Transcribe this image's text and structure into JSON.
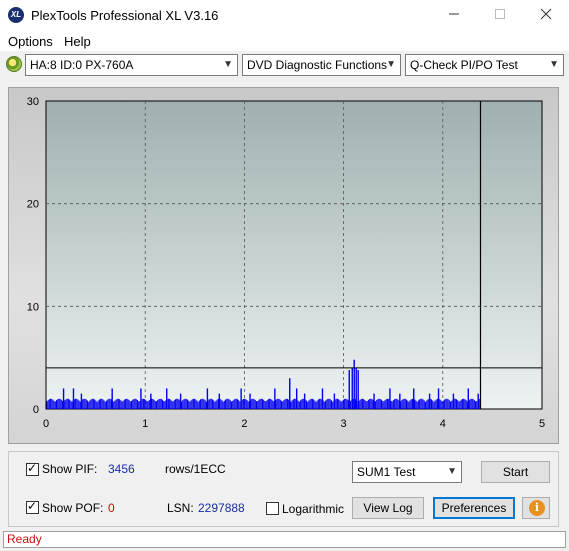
{
  "window": {
    "title": "PlexTools Professional XL V3.16",
    "icon_text": "XL"
  },
  "menu": {
    "options": "Options",
    "help": "Help"
  },
  "toolbar": {
    "drive": "HA:8 ID:0  PX-760A",
    "function": "DVD Diagnostic Functions",
    "test": "Q-Check PI/PO Test"
  },
  "chart_data": {
    "type": "bar",
    "xlim": [
      0,
      5
    ],
    "ylim": [
      0,
      30
    ],
    "x_ticks": [
      "0",
      "1",
      "2",
      "3",
      "4",
      "5"
    ],
    "y_ticks": [
      "0",
      "10",
      "20",
      "30"
    ],
    "grid": true,
    "threshold_line": 4,
    "end_marker_x": 4.38,
    "series_color": "#0000ee",
    "baseline_value": 1,
    "spikes": [
      {
        "x": 0.17,
        "y": 2
      },
      {
        "x": 0.27,
        "y": 2
      },
      {
        "x": 0.35,
        "y": 1.5
      },
      {
        "x": 0.66,
        "y": 2
      },
      {
        "x": 0.95,
        "y": 2
      },
      {
        "x": 1.05,
        "y": 1.5
      },
      {
        "x": 1.21,
        "y": 2
      },
      {
        "x": 1.35,
        "y": 1.5
      },
      {
        "x": 1.62,
        "y": 2
      },
      {
        "x": 1.74,
        "y": 1.5
      },
      {
        "x": 1.96,
        "y": 2
      },
      {
        "x": 2.05,
        "y": 1.5
      },
      {
        "x": 2.3,
        "y": 2
      },
      {
        "x": 2.45,
        "y": 3
      },
      {
        "x": 2.52,
        "y": 2
      },
      {
        "x": 2.6,
        "y": 1.5
      },
      {
        "x": 2.78,
        "y": 2
      },
      {
        "x": 2.9,
        "y": 1.5
      },
      {
        "x": 3.05,
        "y": 3.8
      },
      {
        "x": 3.08,
        "y": 4
      },
      {
        "x": 3.1,
        "y": 4.8
      },
      {
        "x": 3.12,
        "y": 4
      },
      {
        "x": 3.14,
        "y": 3.8
      },
      {
        "x": 3.3,
        "y": 1.5
      },
      {
        "x": 3.46,
        "y": 2
      },
      {
        "x": 3.56,
        "y": 1.5
      },
      {
        "x": 3.7,
        "y": 2
      },
      {
        "x": 3.86,
        "y": 1.5
      },
      {
        "x": 3.95,
        "y": 2
      },
      {
        "x": 4.1,
        "y": 1.5
      },
      {
        "x": 4.25,
        "y": 2
      },
      {
        "x": 4.35,
        "y": 1.5
      }
    ]
  },
  "controls": {
    "show_pif_label": "Show PIF:",
    "pif_value": "3456",
    "pif_unit": "rows/1ECC",
    "show_pof_label": "Show POF:",
    "pof_value": "0",
    "lsn_label": "LSN:",
    "lsn_value": "2297888",
    "logarithmic_label": "Logarithmic",
    "sum_select": "SUM1 Test",
    "start_button": "Start",
    "view_log_button": "View Log",
    "preferences_button": "Preferences",
    "info_symbol": "i"
  },
  "status": {
    "text": "Ready"
  }
}
